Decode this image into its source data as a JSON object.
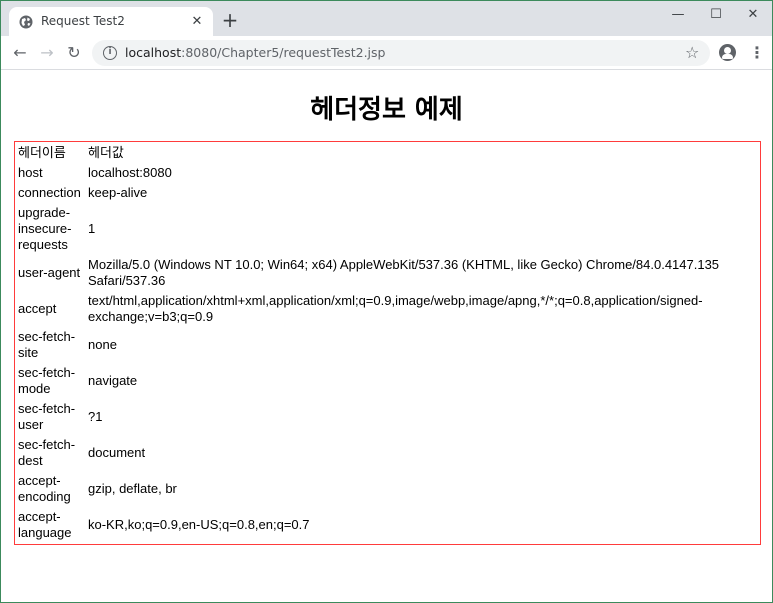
{
  "browser": {
    "tab_title": "Request Test2",
    "url_host": "localhost",
    "url_path": ":8080/Chapter5/requestTest2.jsp"
  },
  "page": {
    "title": "헤더정보 예제",
    "table": {
      "columns": [
        "헤더이름",
        "헤더값"
      ],
      "rows": [
        {
          "name": "host",
          "value": "localhost:8080"
        },
        {
          "name": "connection",
          "value": "keep-alive"
        },
        {
          "name": "upgrade-insecure-requests",
          "value": "1"
        },
        {
          "name": "user-agent",
          "value": "Mozilla/5.0 (Windows NT 10.0; Win64; x64) AppleWebKit/537.36 (KHTML, like Gecko) Chrome/84.0.4147.135 Safari/537.36"
        },
        {
          "name": "accept",
          "value": "text/html,application/xhtml+xml,application/xml;q=0.9,image/webp,image/apng,*/*;q=0.8,application/signed-exchange;v=b3;q=0.9"
        },
        {
          "name": "sec-fetch-site",
          "value": "none"
        },
        {
          "name": "sec-fetch-mode",
          "value": "navigate"
        },
        {
          "name": "sec-fetch-user",
          "value": "?1"
        },
        {
          "name": "sec-fetch-dest",
          "value": "document"
        },
        {
          "name": "accept-encoding",
          "value": "gzip, deflate, br"
        },
        {
          "name": "accept-language",
          "value": "ko-KR,ko;q=0.9,en-US;q=0.8,en;q=0.7"
        }
      ]
    }
  },
  "colors": {
    "table_border": "#ff3b3b",
    "window_border": "#3c8a5c"
  },
  "icons": [
    "globe-icon",
    "close-icon",
    "plus-icon",
    "minimize-icon",
    "maximize-icon",
    "window-close-icon",
    "back-arrow-icon",
    "forward-arrow-icon",
    "reload-icon",
    "info-icon",
    "star-icon",
    "profile-icon",
    "menu-icon"
  ]
}
